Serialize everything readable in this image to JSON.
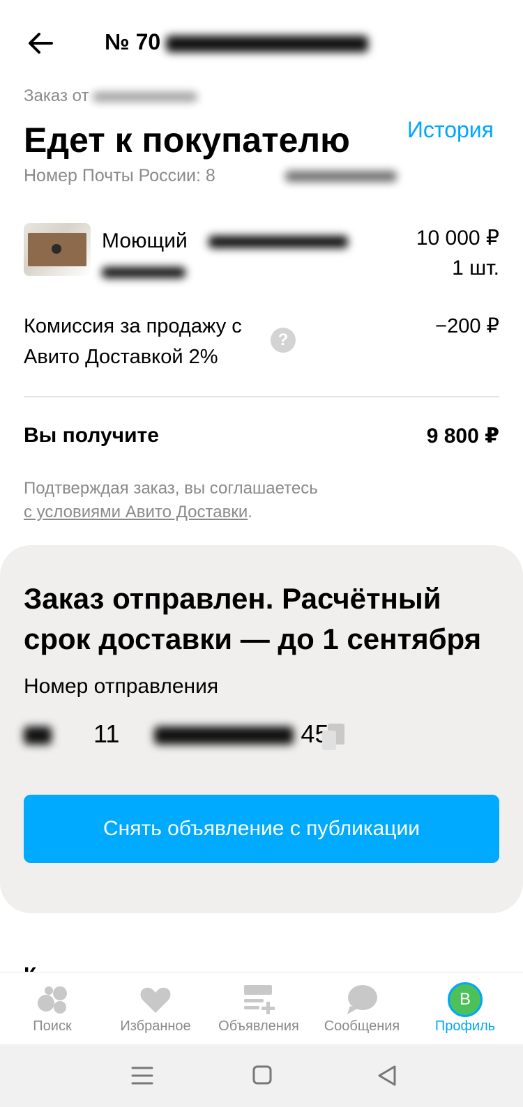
{
  "header": {
    "order_number": "№ 70"
  },
  "order": {
    "date_label": "Заказ от",
    "status": "Едет к покупателю",
    "history_link": "История",
    "post_number_label": "Номер Почты России: 8"
  },
  "item": {
    "title": "Моющий",
    "price": "10 000 ₽",
    "quantity": "1 шт."
  },
  "fee": {
    "label": "Комиссия за продажу с Авито Доставкой 2%",
    "amount": "−200 ₽"
  },
  "summary": {
    "receive_label": "Вы получите",
    "receive_amount": "9 800 ₽"
  },
  "terms": {
    "prefix": "Подтверждая заказ, вы соглашаетесь",
    "link": "с условиями Авито Доставки",
    "suffix": "."
  },
  "shipment": {
    "title": "Заказ отправлен. Расчётный срок доставки — до 1 сентября",
    "tracking_label": "Номер отправления",
    "tracking_number_fragment": "11",
    "tracking_number_tail": "45",
    "cta": "Снять объявление с публикации"
  },
  "nav": {
    "items": [
      {
        "label": "Поиск",
        "icon": "search-icon"
      },
      {
        "label": "Избранное",
        "icon": "heart-icon"
      },
      {
        "label": "Объявления",
        "icon": "listings-icon"
      },
      {
        "label": "Сообщения",
        "icon": "messages-icon"
      },
      {
        "label": "Профиль",
        "icon": "avatar",
        "avatar_letter": "В"
      }
    ],
    "active_color": "#00a6ff"
  },
  "colors": {
    "accent": "#00aaff",
    "muted": "#8a8a8a",
    "card_bg": "#f0efee"
  }
}
